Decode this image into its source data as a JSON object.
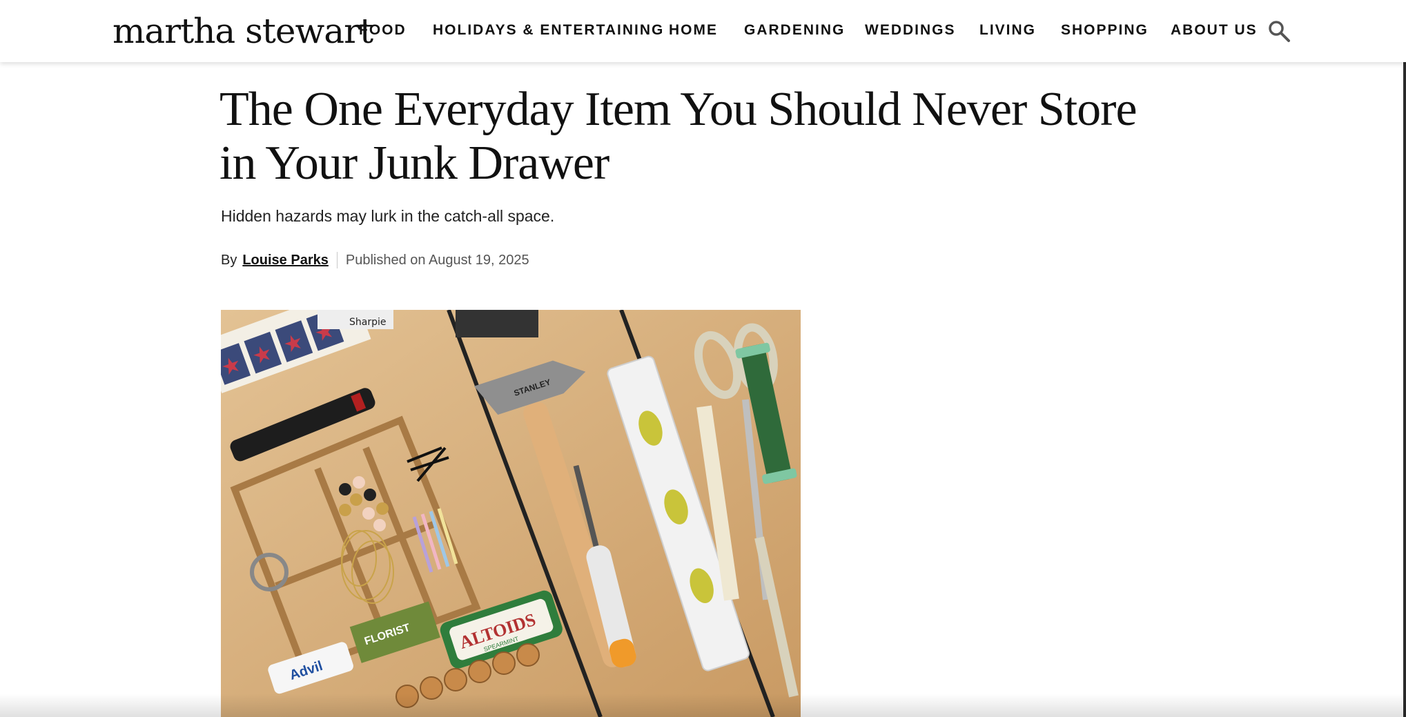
{
  "site": {
    "logo": "martha stewart"
  },
  "nav": {
    "items": [
      {
        "label": "FOOD"
      },
      {
        "label": "HOLIDAYS & ENTERTAINING"
      },
      {
        "label": "HOME"
      },
      {
        "label": "GARDENING"
      },
      {
        "label": "WEDDINGS"
      },
      {
        "label": "LIVING"
      },
      {
        "label": "SHOPPING"
      },
      {
        "label": "ABOUT US"
      }
    ],
    "search_icon": "search-icon"
  },
  "article": {
    "title": "The One Everyday Item You Should Never Store in Your Junk Drawer",
    "subtitle": "Hidden hazards may lurk in the catch-all space.",
    "byline": {
      "prefix": "By",
      "author": "Louise Parks",
      "published": "Published on August 19, 2025"
    },
    "hero_image": {
      "labels": {
        "altoids": "ALTOIDS",
        "florist": "FLORIST",
        "advil": "Advil",
        "sharpie": "Sharpie",
        "stanley": "STANLEY",
        "spearmint": "SPEARMINT"
      }
    }
  },
  "colors": {
    "text": "#111111",
    "wood": "#d9b382",
    "altoids_green": "#2f7d3c",
    "florist_green": "#6f8a3a",
    "header_shadow": "#e6e6e6"
  }
}
